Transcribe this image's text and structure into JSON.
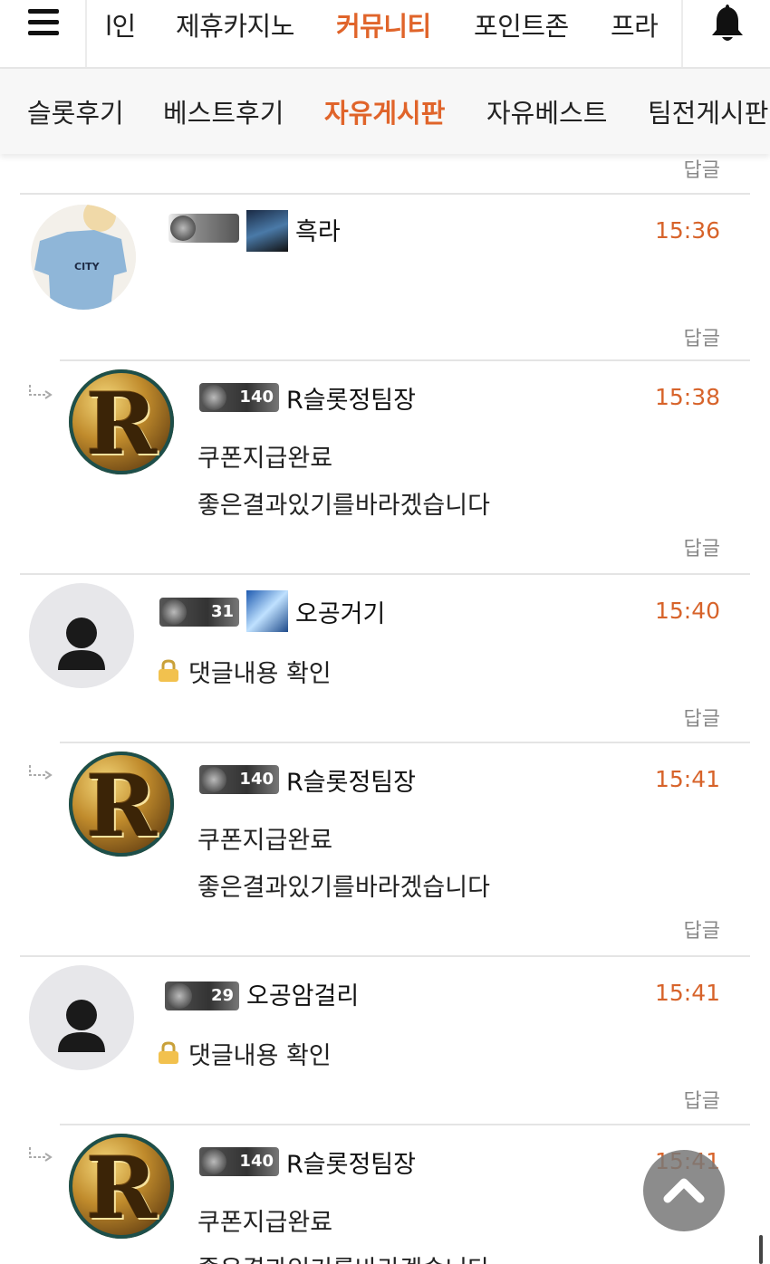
{
  "topnav": {
    "tabs": [
      {
        "label": "l인",
        "active": false
      },
      {
        "label": "제휴카지노",
        "active": false
      },
      {
        "label": "커뮤니티",
        "active": true
      },
      {
        "label": "포인트존",
        "active": false
      },
      {
        "label": "프라",
        "active": false
      }
    ],
    "menu_icon": "hamburger-icon",
    "bell_icon": "bell-icon"
  },
  "subnav": {
    "tabs": [
      {
        "label": "슬롯후기",
        "active": false
      },
      {
        "label": "베스트후기",
        "active": false
      },
      {
        "label": "자유게시판",
        "active": true
      },
      {
        "label": "자유베스트",
        "active": false
      },
      {
        "label": "팀전게시판",
        "active": false
      }
    ]
  },
  "reply_label": "답글",
  "comments": [
    {
      "username": "흑라",
      "time": "15:36",
      "lines": [],
      "avatar": "photo",
      "reply": false
    },
    {
      "username": "R슬롯정팀장",
      "level": "140",
      "time": "15:38",
      "lines": [
        "쿠폰지급완료",
        "좋은결과있기를바라겠습니다"
      ],
      "avatar": "r-logo",
      "reply": true
    },
    {
      "username": "오공거기",
      "level": "31",
      "time": "15:40",
      "lines": [
        "댓글내용 확인"
      ],
      "avatar": "default",
      "reply": false,
      "locked": true
    },
    {
      "username": "R슬롯정팀장",
      "level": "140",
      "time": "15:41",
      "lines": [
        "쿠폰지급완료",
        "좋은결과있기를바라겠습니다"
      ],
      "avatar": "r-logo",
      "reply": true
    },
    {
      "username": "오공암걸리",
      "level": "29",
      "time": "15:41",
      "lines": [
        "댓글내용 확인"
      ],
      "avatar": "default",
      "reply": false,
      "locked": true
    },
    {
      "username": "R슬롯정팀장",
      "level": "140",
      "time": "15:41",
      "lines": [
        "쿠폰지급완료",
        "좋은결과있기를바라겠습니다"
      ],
      "avatar": "r-logo",
      "reply": true
    }
  ],
  "colors": {
    "accent": "#e0642a",
    "time": "#d7632a",
    "muted": "#888888"
  }
}
